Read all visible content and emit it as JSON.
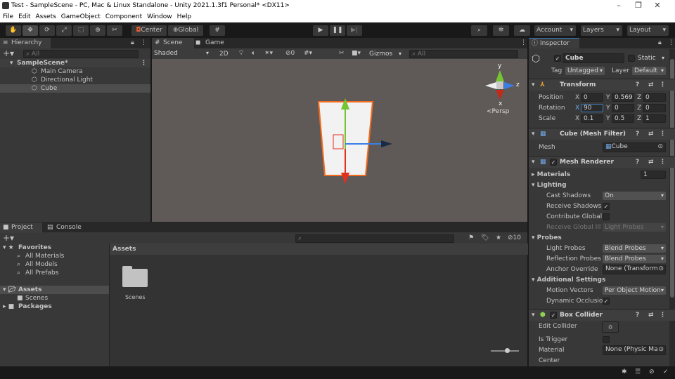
{
  "window": {
    "title": "Test - SampleScene - PC, Mac & Linux Standalone - Unity 2021.1.3f1 Personal* <DX11>"
  },
  "menu": [
    "File",
    "Edit",
    "Assets",
    "GameObject",
    "Component",
    "Window",
    "Help"
  ],
  "toolbar": {
    "center": "Center",
    "global": "Global",
    "account": "Account",
    "layers": "Layers",
    "layout": "Layout"
  },
  "hierarchy": {
    "tab": "Hierarchy",
    "search_placeholder": "All",
    "scene": "SampleScene*",
    "items": [
      "Main Camera",
      "Directional Light",
      "Cube"
    ]
  },
  "scene": {
    "tab_scene": "Scene",
    "tab_game": "Game",
    "shading": "Shaded",
    "mode2d": "2D",
    "hidden_count": "0",
    "gizmos": "Gizmos",
    "search_placeholder": "All",
    "persp": "Persp",
    "axis_x": "x",
    "axis_y": "y",
    "axis_z": "z"
  },
  "project": {
    "tab_project": "Project",
    "tab_console": "Console",
    "favorites": "Favorites",
    "fav_items": [
      "All Materials",
      "All Models",
      "All Prefabs"
    ],
    "assets": "Assets",
    "scenes": "Scenes",
    "packages": "Packages",
    "breadcrumb": "Assets",
    "folder": "Scenes",
    "hidden_count": "10"
  },
  "inspector": {
    "tab": "Inspector",
    "name": "Cube",
    "static": "Static",
    "tag_label": "Tag",
    "tag": "Untagged",
    "layer_label": "Layer",
    "layer": "Default",
    "transform": {
      "title": "Transform",
      "position_label": "Position",
      "rotation_label": "Rotation",
      "scale_label": "Scale",
      "position": {
        "x": "0",
        "y": "0.569",
        "z": "0"
      },
      "rotation": {
        "x": "90",
        "y": "0",
        "z": "0"
      },
      "scale": {
        "x": "0.1",
        "y": "0.5",
        "z": "1"
      }
    },
    "mesh_filter": {
      "title": "Cube (Mesh Filter)",
      "mesh_label": "Mesh",
      "mesh": "Cube"
    },
    "mesh_renderer": {
      "title": "Mesh Renderer",
      "materials_label": "Materials",
      "materials": "1",
      "lighting": "Lighting",
      "cast_shadows_label": "Cast Shadows",
      "cast_shadows": "On",
      "receive_shadows_label": "Receive Shadows",
      "contribute_gi_label": "Contribute Global",
      "receive_gi_label": "Receive Global Illu",
      "receive_gi": "Light Probes",
      "probes": "Probes",
      "light_probes_label": "Light Probes",
      "light_probes": "Blend Probes",
      "reflection_probes_label": "Reflection Probes",
      "reflection_probes": "Blend Probes",
      "anchor_label": "Anchor Override",
      "anchor": "None (Transform",
      "additional": "Additional Settings",
      "motion_vectors_label": "Motion Vectors",
      "motion_vectors": "Per Object Motion",
      "dynamic_occlusion_label": "Dynamic Occlusio"
    },
    "box_collider": {
      "title": "Box Collider",
      "edit_label": "Edit Collider",
      "trigger_label": "Is Trigger",
      "material_label": "Material",
      "material": "None (Physic Ma",
      "center_label": "Center"
    }
  },
  "colors": {
    "accent": "#2c5d87",
    "selection_outline": "#f26b1d",
    "x_axis": "#e0301e",
    "y_axis": "#75c533",
    "z_axis": "#3a7ee8"
  }
}
